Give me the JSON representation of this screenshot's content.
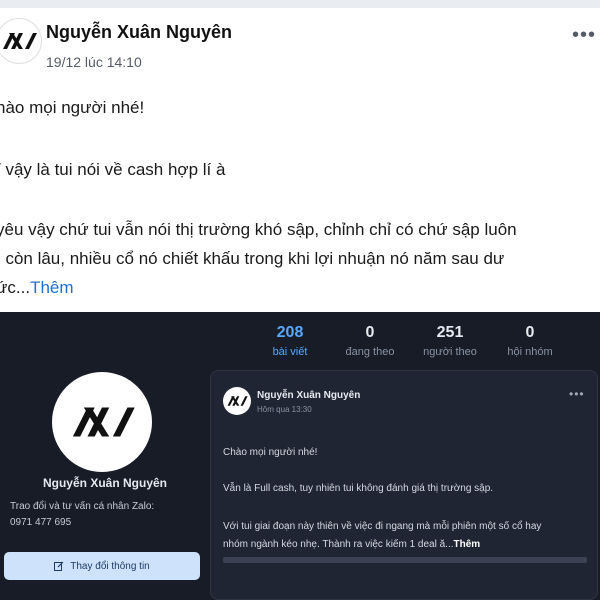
{
  "top_post": {
    "author": "Nguyễn Xuân Nguyên",
    "time": "19/12 lúc 14:10",
    "more_icon": "more-horizontal-icon",
    "lines": [
      "hào mọi người nhé!",
      "/ vậy là tui nói về cash hợp lí à",
      "yêu vậy chứ tui vẫn nói thị trường khó sập, chỉnh chỉ có chứ sập luôn",
      "ì còn lâu, nhiều cổ nó chiết khấu trong khi lợi nhuận nó năm sau dư",
      "ức..."
    ],
    "more_label": "Thêm"
  },
  "profile": {
    "stats": [
      {
        "value": "208",
        "label": "bài viết"
      },
      {
        "value": "0",
        "label": "đang theo"
      },
      {
        "value": "251",
        "label": "người theo"
      },
      {
        "value": "0",
        "label": "hội nhóm"
      }
    ],
    "name": "Nguyễn Xuân Nguyên",
    "bio_line1": "Trao đổi và tư vấn cá nhân Zalo:",
    "bio_line2": "0971 477 695",
    "edit_button": "Thay đổi thông tin",
    "edit_icon": "edit-icon"
  },
  "profile_post": {
    "author": "Nguyễn Xuân Nguyên",
    "time": "Hôm qua 13:30",
    "lines": [
      "Chào mọi người nhé!",
      "Vẫn là Full cash, tuy nhiên tui không đánh giá thị trường sập.",
      "Với tui giai đoạn này thiên về việc đi ngang mà mỗi phiên một số cổ hay",
      "nhóm ngành kéo nhẹ. Thành ra việc kiếm 1 deal ă..."
    ],
    "more_label": "Thêm"
  },
  "colors": {
    "link": "#1d6fd6",
    "dark_bg": "#171c27",
    "active_stat": "#5aa7ff"
  }
}
